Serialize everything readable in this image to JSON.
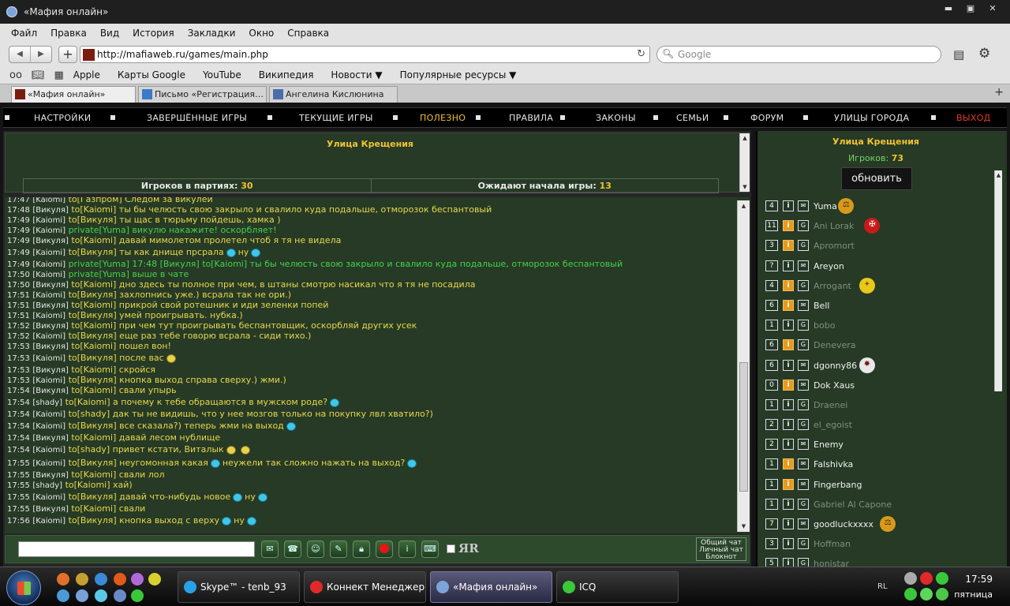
{
  "window": {
    "title": "«Мафия онлайн»"
  },
  "menubar": [
    "Файл",
    "Правка",
    "Вид",
    "История",
    "Закладки",
    "Окно",
    "Справка"
  ],
  "address": {
    "url": "http://mafiaweb.ru/games/main.php",
    "search_placeholder": "Google"
  },
  "bookmarks": [
    "Apple",
    "Карты Google",
    "YouTube",
    "Википедия",
    "Новости ▼",
    "Популярные ресурсы ▼"
  ],
  "tabs": [
    "«Мафия онлайн»",
    "Письмо «Регистрация…",
    "Ангелина Кислюнина"
  ],
  "nav": [
    "НАСТРОЙКИ",
    "ЗАВЕРШЁННЫЕ ИГРЫ",
    "ТЕКУЩИЕ ИГРЫ",
    "ПОЛЕЗНО",
    "ПРАВИЛА",
    "ЗАКОНЫ",
    "СЕМЬИ",
    "ФОРУМ",
    "УЛИЦЫ ГОРОДА",
    "ВЫХОД"
  ],
  "colors": {
    "accent": "#f0c330",
    "chat_text": "#e8d84a",
    "private_text": "#46d24a",
    "exit": "#e03a2a",
    "panel_bg": "#263a26"
  },
  "info": {
    "street": "Улица Крещения",
    "players_label": "Игроков в партиях:",
    "players_value": "30",
    "waiting_label": "Ожидают начала игры:",
    "waiting_value": "13"
  },
  "chat": [
    {
      "time": "17:47",
      "nick": "[Kaiomi]",
      "msg": "to[Газпром] Следом за викулей",
      "priv": false
    },
    {
      "time": "17:48",
      "nick": "[Викуля]",
      "msg": "to[Kaiomi] ты бы челюсть свою закрыло и свалило куда подальше, отморозок беспантовый",
      "priv": false
    },
    {
      "time": "17:49",
      "nick": "[Kaiomi]",
      "msg": "to[Викуля] ты щас в тюрьму пойдешь, хамка )",
      "priv": false
    },
    {
      "time": "17:49",
      "nick": "[Kaiomi]",
      "msg": "private[Yuma] викулю накажите! оскорбляет!",
      "priv": true
    },
    {
      "time": "17:49",
      "nick": "[Викуля]",
      "msg": "to[Kaiomi] давай мимолетом пролетел чтоб я тя не видела",
      "priv": false
    },
    {
      "time": "17:49",
      "nick": "[Kaiomi]",
      "msg": "to[Викуля] ты как днище прсрала",
      "priv": false,
      "tail": "ну",
      "smiles": 2
    },
    {
      "time": "17:49",
      "nick": "[Kaiomi]",
      "msg": "private[Yuma] 17:48 [Викуля] to[Kaiomi] ты бы челюсть свою закрыло и свалило куда подальше, отморозок беспантовый",
      "priv": true
    },
    {
      "time": "17:50",
      "nick": "[Kaiomi]",
      "msg": "private[Yuma] выше в чате",
      "priv": true
    },
    {
      "time": "17:50",
      "nick": "[Викуля]",
      "msg": "to[Kaiomi] дно здесь ты полное при чем, в штаны смотрю насикал что я тя не посадила",
      "priv": false
    },
    {
      "time": "17:51",
      "nick": "[Kaiomi]",
      "msg": "to[Викуля] захлопнись уже.) всрала так не ори.)",
      "priv": false
    },
    {
      "time": "17:51",
      "nick": "[Викуля]",
      "msg": "to[Kaiomi] прикрой свой ротешник и иди зеленки попей",
      "priv": false
    },
    {
      "time": "17:51",
      "nick": "[Kaiomi]",
      "msg": "to[Викуля] умей проигрывать. нубка.)",
      "priv": false
    },
    {
      "time": "17:52",
      "nick": "[Викуля]",
      "msg": "to[Kaiomi] при чем тут проигрывать беспантовщик, оскорбляй других усек",
      "priv": false
    },
    {
      "time": "17:52",
      "nick": "[Kaiomi]",
      "msg": "to[Викуля] еще раз тебе говорю всрала - сиди тихо.)",
      "priv": false
    },
    {
      "time": "17:53",
      "nick": "[Викуля]",
      "msg": "to[Kaiomi] пошел вон!",
      "priv": false
    },
    {
      "time": "17:53",
      "nick": "[Kaiomi]",
      "msg": "to[Викуля] после вас",
      "priv": false,
      "smiles": 1,
      "gold": true
    },
    {
      "time": "17:53",
      "nick": "[Викуля]",
      "msg": "to[Kaiomi] скройся",
      "priv": false
    },
    {
      "time": "17:53",
      "nick": "[Kaiomi]",
      "msg": "to[Викуля] кнопка выход справа сверху.) жми.)",
      "priv": false
    },
    {
      "time": "17:54",
      "nick": "[Викуля]",
      "msg": "to[Kaiomi] свали упырь",
      "priv": false
    },
    {
      "time": "17:54",
      "nick": "[shady]",
      "msg": "to[Kaiomi] а почему к тебе обращаются в мужском роде?",
      "priv": false,
      "smiles": 1
    },
    {
      "time": "17:54",
      "nick": "[Kaiomi]",
      "msg": "to[shady] дак ты не видишь, что у нее мозгов только на покупку лвл хватило?)",
      "priv": false
    },
    {
      "time": "17:54",
      "nick": "[Kaiomi]",
      "msg": "to[Викуля] все сказала?) теперь жми на выход",
      "priv": false,
      "smiles": 1
    },
    {
      "time": "17:54",
      "nick": "[Викуля]",
      "msg": "to[Kaiomi] давай лесом нублище",
      "priv": false
    },
    {
      "time": "17:54",
      "nick": "[Kaiomi]",
      "msg": "to[shady] привет кстати, Виталык",
      "priv": false,
      "smiles": 2,
      "gold": true
    },
    {
      "time": "17:55",
      "nick": "[Kaiomi]",
      "msg": "to[Викуля] неугомонная какая",
      "priv": false,
      "tail": "неужели так сложно нажать на выход?",
      "smiles": 2
    },
    {
      "time": "17:55",
      "nick": "[Викуля]",
      "msg": "to[Kaiomi] свали лол",
      "priv": false
    },
    {
      "time": "17:55",
      "nick": "[shady]",
      "msg": "to[Kaiomi] хай)",
      "priv": false
    },
    {
      "time": "17:55",
      "nick": "[Kaiomi]",
      "msg": "to[Викуля] давай что-нибудь новое",
      "priv": false,
      "tail": "ну",
      "smiles": 2
    },
    {
      "time": "17:55",
      "nick": "[Викуля]",
      "msg": "to[Kaiomi] свали",
      "priv": false
    },
    {
      "time": "17:56",
      "nick": "[Kaiomi]",
      "msg": "to[Викуля] кнопка выход с верху",
      "priv": false,
      "tail": "ну",
      "smiles": 2
    }
  ],
  "chatmode": [
    "Общий чат",
    "Личный чат",
    "Блокнот"
  ],
  "yalabel": "ЯR",
  "sidebar": {
    "street": "Улица Крещения",
    "players_label": "Игроков:",
    "players_value": "73",
    "refresh": "обновить",
    "players": [
      {
        "n": "4",
        "i": "plain",
        "e": "env",
        "name": "Yuma",
        "dim": false,
        "badge": "scales"
      },
      {
        "n": "11",
        "i": "orange",
        "e": "G",
        "name": "Ani Lorak",
        "dim": true,
        "badge": "cross"
      },
      {
        "n": "3",
        "i": "orange",
        "e": "G",
        "name": "Apromort",
        "dim": true,
        "badge": ""
      },
      {
        "n": "?",
        "i": "plain",
        "e": "env",
        "name": "Areyon",
        "dim": false,
        "badge": ""
      },
      {
        "n": "4",
        "i": "orange",
        "e": "G",
        "name": "Arrogant",
        "dim": true,
        "badge": "eagle"
      },
      {
        "n": "6",
        "i": "orange",
        "e": "env",
        "name": "Bell",
        "dim": false,
        "badge": ""
      },
      {
        "n": "1",
        "i": "plain",
        "e": "G",
        "name": "bobo",
        "dim": true,
        "badge": ""
      },
      {
        "n": "6",
        "i": "orange",
        "e": "G",
        "name": "Denevera",
        "dim": true,
        "badge": ""
      },
      {
        "n": "6",
        "i": "plain",
        "e": "env",
        "name": "dgonny86",
        "dim": false,
        "badge": "star"
      },
      {
        "n": "0",
        "i": "orange",
        "e": "env",
        "name": "Dok Xaus",
        "dim": false,
        "badge": ""
      },
      {
        "n": "1",
        "i": "plain",
        "e": "G",
        "name": "Draenei",
        "dim": true,
        "badge": ""
      },
      {
        "n": "2",
        "i": "plain",
        "e": "G",
        "name": "el_egoist",
        "dim": true,
        "badge": ""
      },
      {
        "n": "2",
        "i": "plain",
        "e": "env",
        "name": "Enemy",
        "dim": false,
        "badge": ""
      },
      {
        "n": "1",
        "i": "orange",
        "e": "env",
        "name": "Falshivka",
        "dim": false,
        "badge": ""
      },
      {
        "n": "1",
        "i": "orange",
        "e": "env",
        "name": "Fingerbang",
        "dim": false,
        "badge": ""
      },
      {
        "n": "1",
        "i": "plain",
        "e": "G",
        "name": "Gabriel Al Capone",
        "dim": true,
        "badge": ""
      },
      {
        "n": "7",
        "i": "plain",
        "e": "env",
        "name": "goodluckxxxx",
        "dim": false,
        "badge": "scales"
      },
      {
        "n": "3",
        "i": "plain",
        "e": "G",
        "name": "Hoffman",
        "dim": true,
        "badge": ""
      },
      {
        "n": "5",
        "i": "plain",
        "e": "G",
        "name": "honistar",
        "dim": true,
        "badge": ""
      }
    ]
  },
  "taskbar": {
    "items": [
      "Skype™ - tenb_93",
      "Коннект Менеджер",
      "«Мафия онлайн»",
      "ICQ"
    ],
    "lang": "RL",
    "time": "17:59",
    "day": "пятница"
  }
}
